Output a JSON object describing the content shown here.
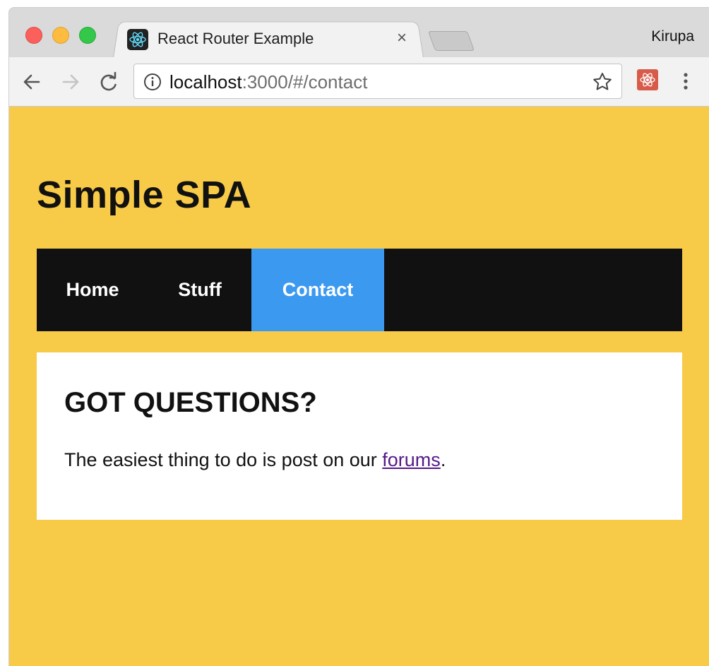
{
  "browser": {
    "tab_title": "React Router Example",
    "tab_close": "×",
    "profile_name": "Kirupa",
    "url_host": "localhost",
    "url_path": ":3000/#/contact",
    "icons": {
      "back": "back-arrow-icon",
      "forward": "forward-arrow-icon",
      "reload": "reload-icon",
      "info": "info-icon",
      "bookmark": "star-icon",
      "extension": "react-extension-icon",
      "menu": "kebab-menu-icon",
      "favicon": "react-logo-icon"
    },
    "colors": {
      "close_red": "#fc605c",
      "minimize_yellow": "#fdbc40",
      "zoom_green": "#34c84a"
    }
  },
  "page": {
    "site_title": "Simple SPA",
    "nav": {
      "items": [
        {
          "label": "Home",
          "active": false
        },
        {
          "label": "Stuff",
          "active": false
        },
        {
          "label": "Contact",
          "active": true
        }
      ]
    },
    "content": {
      "heading": "GOT QUESTIONS?",
      "text_before": "The easiest thing to do is post on our ",
      "link_text": "forums",
      "text_after": "."
    },
    "colors": {
      "background": "#f7ca47",
      "nav_bg": "#111111",
      "nav_active": "#3b99f0",
      "link": "#551a8b"
    }
  }
}
